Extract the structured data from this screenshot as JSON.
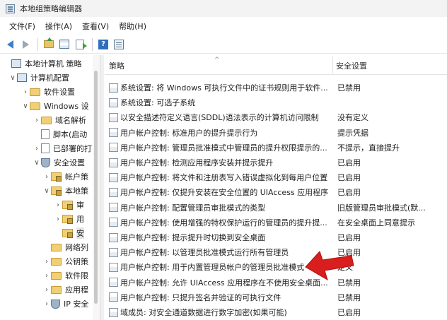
{
  "window": {
    "title": "本地组策略编辑器"
  },
  "menu": {
    "items": [
      "文件(F)",
      "操作(A)",
      "查看(V)",
      "帮助(H)"
    ]
  },
  "tree": {
    "items": [
      {
        "label": "本地计算机 策略",
        "toggle": "",
        "icon": "pc"
      },
      {
        "label": "计算机配置",
        "toggle": "∨",
        "icon": "pc"
      },
      {
        "label": "软件设置",
        "toggle": "›",
        "icon": "folder"
      },
      {
        "label": "Windows 设",
        "toggle": "∨",
        "icon": "folder"
      },
      {
        "label": "域名解析",
        "toggle": "›",
        "icon": "folder"
      },
      {
        "label": "脚本(启动",
        "toggle": "",
        "icon": "doc"
      },
      {
        "label": "已部署的打",
        "toggle": "›",
        "icon": "doc"
      },
      {
        "label": "安全设置",
        "toggle": "∨",
        "icon": "shield"
      },
      {
        "label": "帐户策",
        "toggle": "›",
        "icon": "folder-lock"
      },
      {
        "label": "本地策",
        "toggle": "∨",
        "icon": "folder-lock"
      },
      {
        "label": "审",
        "toggle": "›",
        "icon": "folder-lock"
      },
      {
        "label": "用",
        "toggle": "›",
        "icon": "folder-lock"
      },
      {
        "label": "安",
        "toggle": "",
        "icon": "folder-lock"
      },
      {
        "label": "网络列",
        "toggle": "",
        "icon": "folder"
      },
      {
        "label": "公钥策",
        "toggle": "›",
        "icon": "folder"
      },
      {
        "label": "软件限",
        "toggle": "›",
        "icon": "folder"
      },
      {
        "label": "应用程",
        "toggle": "›",
        "icon": "folder"
      },
      {
        "label": "IP 安全",
        "toggle": "›",
        "icon": "shield"
      }
    ]
  },
  "list": {
    "columns": {
      "policy": "策略",
      "setting": "安全设置"
    },
    "rows": [
      {
        "policy": "系统设置: 将 Windows 可执行文件中的证书规则用于软件...",
        "setting": "已禁用"
      },
      {
        "policy": "系统设置: 可选子系统",
        "setting": ""
      },
      {
        "policy": "以安全描述符定义语言(SDDL)语法表示的计算机访问限制",
        "setting": "没有定义"
      },
      {
        "policy": "用户帐户控制: 标准用户的提升提示行为",
        "setting": "提示凭据"
      },
      {
        "policy": "用户帐户控制: 管理员批准模式中管理员的提升权限提示的...",
        "setting": "不提示，直接提升"
      },
      {
        "policy": "用户帐户控制: 检测应用程序安装并提示提升",
        "setting": "已启用"
      },
      {
        "policy": "用户帐户控制: 将文件和注册表写入错误虚拟化到每用户位置",
        "setting": "已启用"
      },
      {
        "policy": "用户帐户控制: 仅提升安装在安全位置的 UIAccess 应用程序",
        "setting": "已启用"
      },
      {
        "policy": "用户帐户控制:  配置管理员审批模式的类型",
        "setting": "旧版管理员审批模式(默..."
      },
      {
        "policy": "用户帐户控制:  使用增强的特权保护运行的管理员的提升提...",
        "setting": "在安全桌面上同意提示"
      },
      {
        "policy": "用户帐户控制: 提示提升时切换到安全桌面",
        "setting": "已启用"
      },
      {
        "policy": "用户帐户控制: 以管理员批准模式运行所有管理员",
        "setting": "已启用"
      },
      {
        "policy": "用户帐户控制: 用于内置管理员帐户的管理员批准模式",
        "setting": "定义"
      },
      {
        "policy": "用户帐户控制: 允许 UIAccess 应用程序在不使用安全桌面...",
        "setting": "已禁用"
      },
      {
        "policy": "用户帐户控制: 只提升签名并验证的可执行文件",
        "setting": "已禁用"
      },
      {
        "policy": "域成员: 对安全通道数据进行数字加密(如果可能)",
        "setting": "已启用"
      }
    ]
  },
  "colors": {
    "accent_arrow": "#d81e1e",
    "folder": "#f1cf75",
    "nav_arrow": "#3a7fc9"
  },
  "icons": [
    "back-arrow-icon",
    "forward-arrow-icon",
    "up-folder-icon",
    "show-hide-tree-icon",
    "export-list-icon",
    "help-icon",
    "properties-icon",
    "policy-item-icon"
  ]
}
